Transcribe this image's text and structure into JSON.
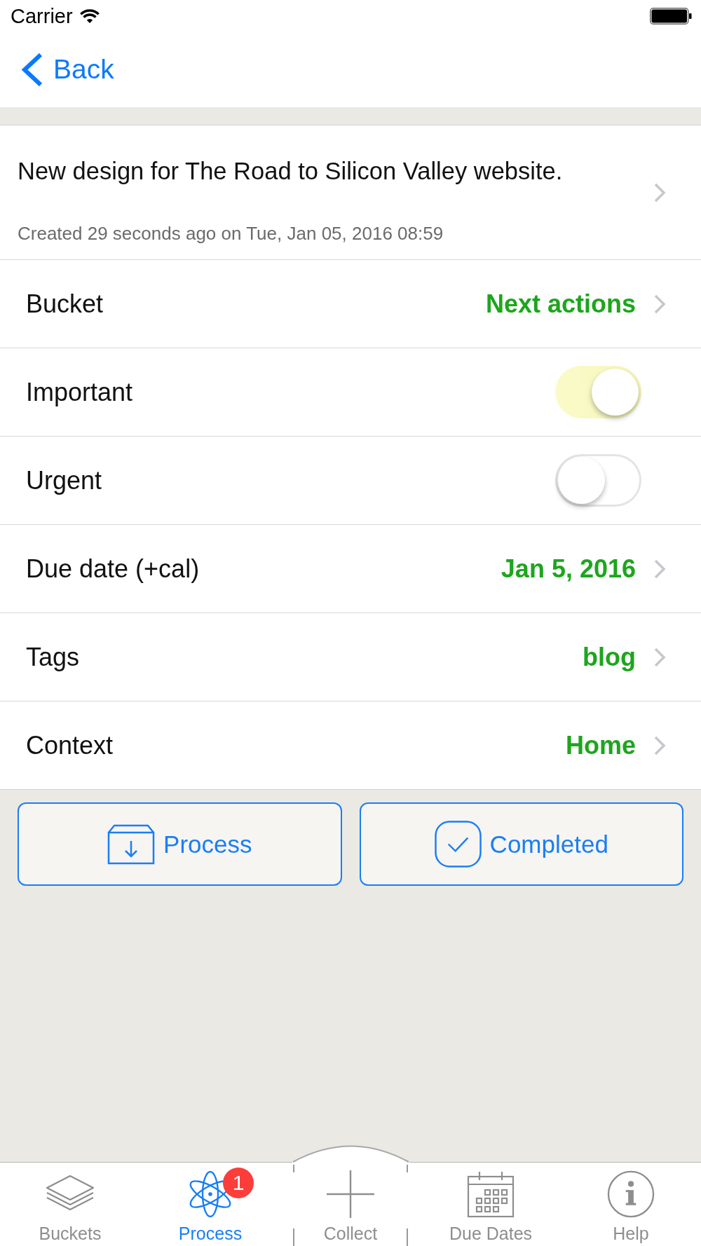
{
  "status_bar": {
    "carrier": "Carrier"
  },
  "nav_bar": {
    "back": "Back"
  },
  "note": {
    "title": "New design for The Road to Silicon Valley website.",
    "created": "Created 29 seconds ago on Tue, Jan 05, 2016 08:59"
  },
  "rows": [
    {
      "kind": "value",
      "label": "Bucket",
      "value": "Next actions"
    },
    {
      "kind": "toggle",
      "label": "Important",
      "on": true
    },
    {
      "kind": "toggle",
      "label": "Urgent",
      "on": false
    },
    {
      "kind": "value",
      "label": "Due date (+cal)",
      "value": "Jan 5, 2016"
    },
    {
      "kind": "value",
      "label": "Tags",
      "value": "blog"
    },
    {
      "kind": "value",
      "label": "Context",
      "value": "Home"
    }
  ],
  "actions": [
    {
      "label": "Process"
    },
    {
      "label": "Completed"
    }
  ],
  "tab_bar": {
    "tabs": [
      {
        "label": "Buckets",
        "kind": "standard",
        "selected": false
      },
      {
        "label": "Process",
        "kind": "standard",
        "selected": true,
        "badge": "1"
      },
      {
        "label": "Collect",
        "kind": "raised",
        "selected": false
      },
      {
        "label": "Due Dates",
        "kind": "standard",
        "selected": false
      },
      {
        "label": "Help",
        "kind": "standard",
        "selected": false
      }
    ]
  }
}
